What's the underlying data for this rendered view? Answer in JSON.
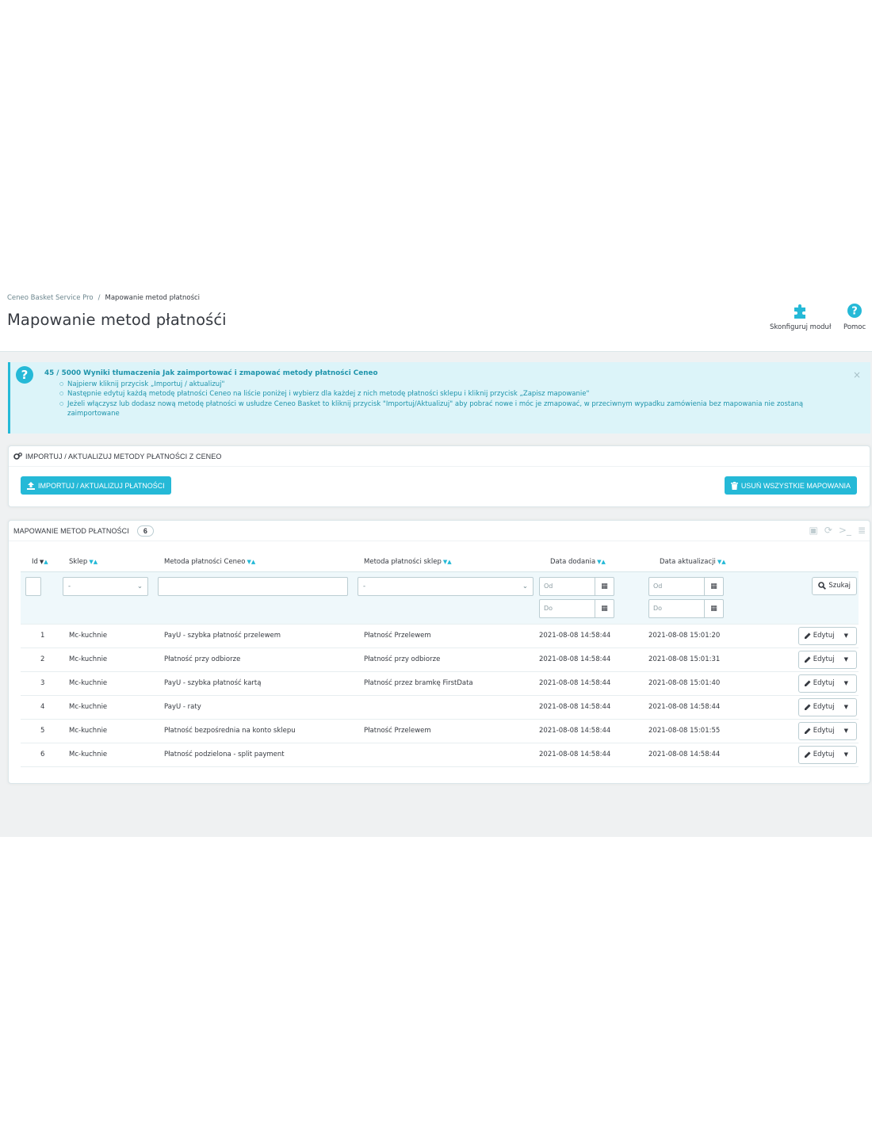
{
  "breadcrumb": {
    "parent": "Ceneo Basket Service Pro",
    "separator": "/",
    "current": "Mapowanie metod płatności"
  },
  "page_title": "Mapowanie metod płatnośći",
  "toolbar": {
    "configure_label": "Skonfiguruj moduł",
    "help_label": "Pomoc"
  },
  "alert": {
    "title": "45 / 5000 Wyniki tłumaczenia Jak zaimportować i zmapować metody płatności Ceneo",
    "items": [
      "Najpierw kliknij przycisk „Importuj / aktualizuj\"",
      "Następnie edytuj każdą metodę płatności Ceneo na liście poniżej i wybierz dla każdej z nich metodę płatności sklepu i kliknij przycisk „Zapisz mapowanie\"",
      "Jeżeli włączysz lub dodasz nową metodę płatności w usłudze Ceneo Basket to kliknij przycisk \"Importuj/Aktualizuj\" aby pobrać nowe i móc je zmapować, w przeciwnym wypadku zamówienia bez mapowania nie zostaną zaimportowane"
    ],
    "close": "×"
  },
  "import_panel": {
    "heading": "Importuj / aktualizuj metody płatności z Ceneo",
    "import_button": "Importuj / aktualizuj płatności",
    "delete_button": "Usuń wszystkie mapowania"
  },
  "list_panel": {
    "heading": "Mapowanie metod płatności",
    "count": "6",
    "columns": [
      "Id",
      "Sklep",
      "Metoda płatności Ceneo",
      "Metoda płatności sklep",
      "Data dodania",
      "Data aktualizacji"
    ],
    "filters": {
      "shop_select": "-",
      "shop_payment_select": "-",
      "date_from_placeholder": "Od",
      "date_to_placeholder": "Do",
      "search_button": "Szukaj"
    },
    "row_action": "Edytuj",
    "rows": [
      {
        "id": "1",
        "shop": "Mc-kuchnie",
        "ceneo_method": "PayU - szybka płatność przelewem",
        "shop_method": "Płatność Przelewem",
        "added": "2021-08-08 14:58:44",
        "updated": "2021-08-08 15:01:20"
      },
      {
        "id": "2",
        "shop": "Mc-kuchnie",
        "ceneo_method": "Płatność przy odbiorze",
        "shop_method": "Płatność przy odbiorze",
        "added": "2021-08-08 14:58:44",
        "updated": "2021-08-08 15:01:31"
      },
      {
        "id": "3",
        "shop": "Mc-kuchnie",
        "ceneo_method": "PayU - szybka płatność kartą",
        "shop_method": "Płatność przez bramkę FirstData",
        "added": "2021-08-08 14:58:44",
        "updated": "2021-08-08 15:01:40"
      },
      {
        "id": "4",
        "shop": "Mc-kuchnie",
        "ceneo_method": "PayU - raty",
        "shop_method": "",
        "added": "2021-08-08 14:58:44",
        "updated": "2021-08-08 14:58:44"
      },
      {
        "id": "5",
        "shop": "Mc-kuchnie",
        "ceneo_method": "Płatność bezpośrednia na konto sklepu",
        "shop_method": "Płatność Przelewem",
        "added": "2021-08-08 14:58:44",
        "updated": "2021-08-08 15:01:55"
      },
      {
        "id": "6",
        "shop": "Mc-kuchnie",
        "ceneo_method": "Płatność podzielona - split payment",
        "shop_method": "",
        "added": "2021-08-08 14:58:44",
        "updated": "2021-08-08 14:58:44"
      }
    ]
  },
  "colors": {
    "accent": "#25b9d7",
    "alert_bg": "#dcf4f9",
    "page_bg": "#eff1f2",
    "text": "#363a41"
  }
}
